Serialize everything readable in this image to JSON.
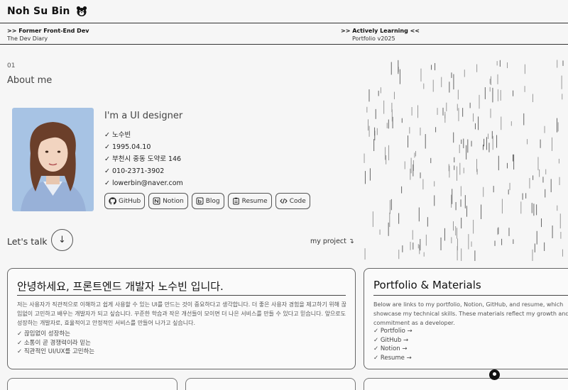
{
  "header": {
    "name": "Noh Su Bin",
    "icon": "bear-face-icon",
    "left_title": ">> Former Front-End Dev",
    "left_subtitle": "The Dev Diary",
    "right_title": ">> Actively Learning <<",
    "right_subtitle": "Portfolio v2025"
  },
  "about": {
    "number": "01",
    "title": "About me",
    "intro": "I'm a UI designer",
    "info": [
      "✓ 노수빈",
      "✓ 1995.04.10",
      "✓ 부천시 중동 도약로 146",
      "✓ 010-2371-3902",
      "✓ lowerbin@naver.com"
    ],
    "links": [
      {
        "label": "GitHub",
        "icon": "github-icon"
      },
      {
        "label": "Notion",
        "icon": "notion-icon"
      },
      {
        "label": "Blog",
        "icon": "blog-icon"
      },
      {
        "label": "Resume",
        "icon": "clipboard-icon"
      },
      {
        "label": "Code",
        "icon": "code-icon"
      }
    ]
  },
  "talk": {
    "label": "Let's talk",
    "button_icon": "↓",
    "project_link": "my project ↴"
  },
  "cards": {
    "hello": {
      "title": "안녕하세요, 프론트엔드 개발자 노수빈 입니다.",
      "body": "저는 사용자가 직관적으로 이해하고 쉽게 사용할 수 있는 UI를 만드는 것이 중요하다고 생각합니다. 더 좋은 사용자 경험을 제고하기 위해 끊임없이 고민하고 배우는 개발자가 되고 싶습니다. 꾸준한 학습과 작은 개선들이 모이면 더 나은 서비스를 만들 수 있다고 믿습니다. 앞으로도 성장하는 개발자로, 효율적이고 안정적인 서비스를 만들어 나가고 싶습니다.",
      "items": [
        "✓ 끊임없이 성장하는",
        "✓ 소통이 곧 경쟁력이라 믿는",
        "✓ 직관적인 UI/UX를 고민하는"
      ]
    },
    "portfolio": {
      "title": "Portfolio & Materials",
      "body": "Below are links to my portfolio, Notion, GitHub, and resume, which showcase my technical skills. These materials reflect my growth and commitment as a developer.",
      "items": [
        "✓ Portfolio →",
        "✓ GitHub →",
        "✓ Notion →",
        "✓ Resume →"
      ]
    }
  },
  "colors": {
    "background": "#f6f6f6",
    "text": "#222222",
    "border": "#666666"
  }
}
